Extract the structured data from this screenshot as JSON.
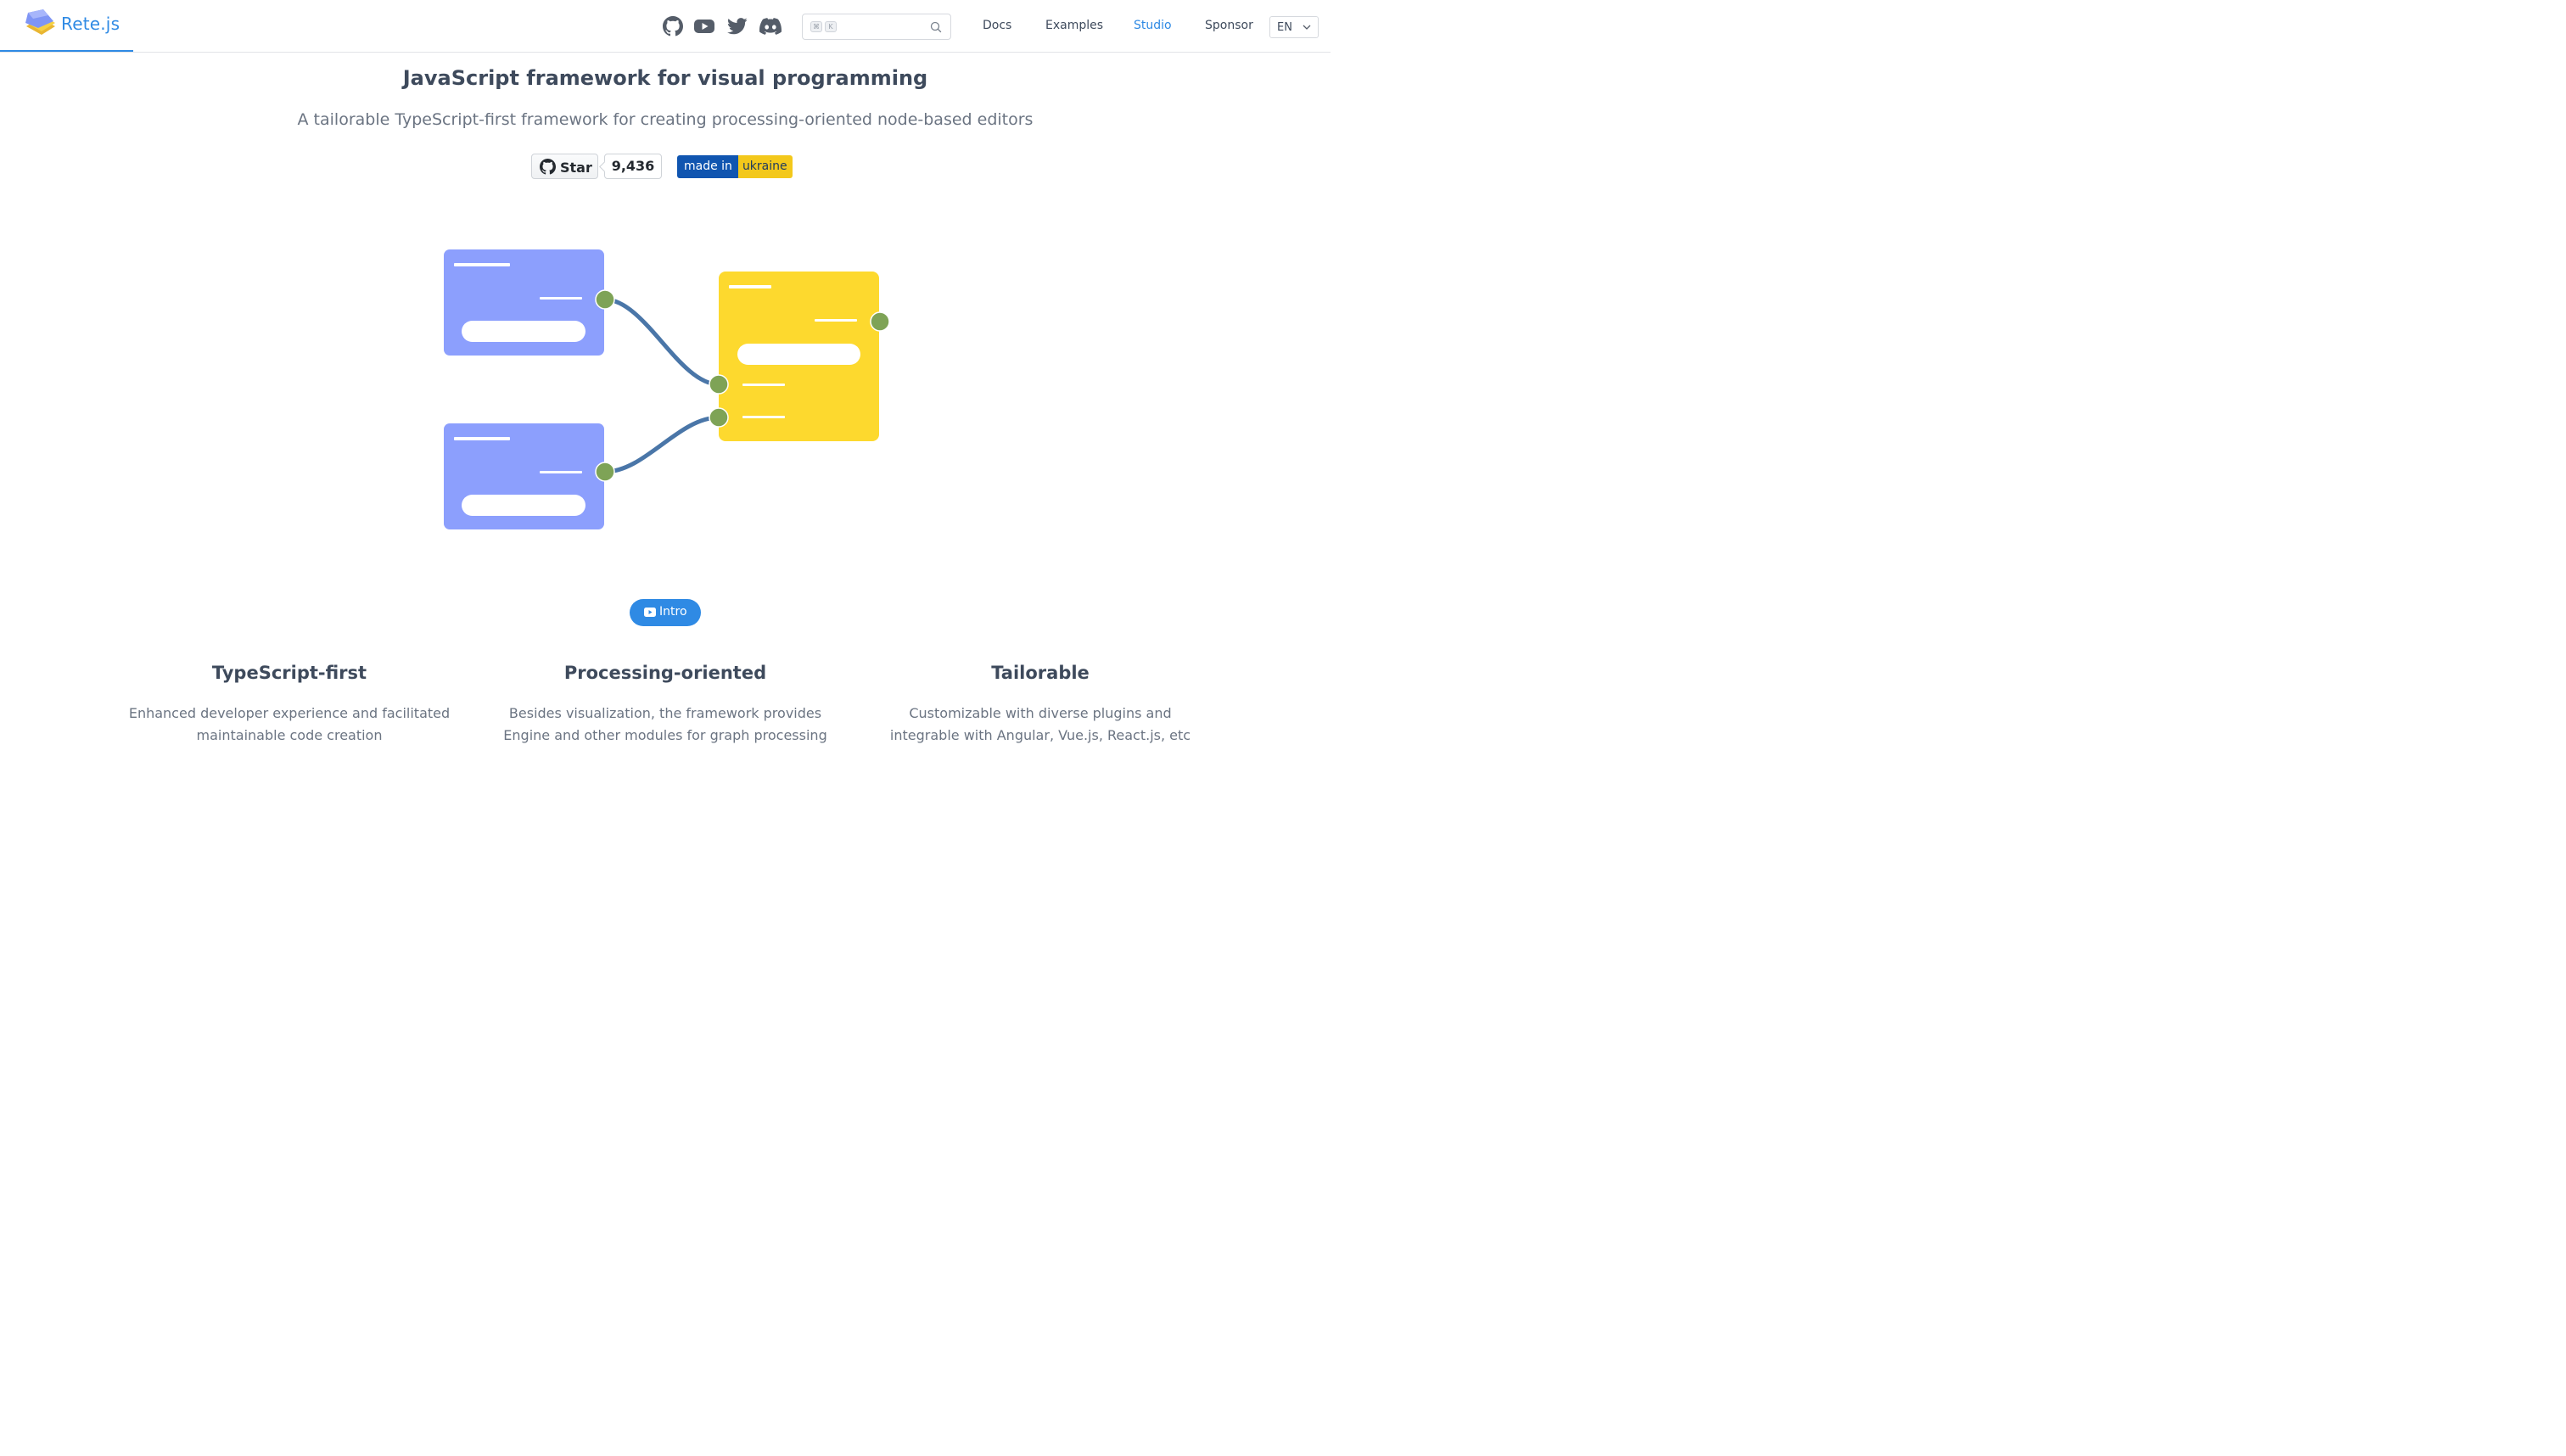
{
  "header": {
    "brand": "Rete.js",
    "social": [
      {
        "name": "github-icon"
      },
      {
        "name": "youtube-icon"
      },
      {
        "name": "twitter-icon"
      },
      {
        "name": "discord-icon"
      }
    ],
    "search": {
      "placeholder": "",
      "shortcut_keys": [
        "⌘",
        "K"
      ]
    },
    "nav": [
      {
        "label": "Docs",
        "active": false
      },
      {
        "label": "Examples",
        "active": false
      },
      {
        "label": "Studio",
        "active": true
      },
      {
        "label": "Sponsor",
        "active": false
      }
    ],
    "language": "EN"
  },
  "hero": {
    "title": "JavaScript framework for visual programming",
    "subtitle": "A tailorable TypeScript-first framework for creating processing-oriented node-based editors",
    "star_label": "Star",
    "star_count": "9,436",
    "badge_left": "made in",
    "badge_right": "ukraine"
  },
  "intro_button": "Intro",
  "features": [
    {
      "title": "TypeScript-first",
      "desc_line1": "Enhanced developer experience and facilitated",
      "desc_line2": "maintainable code creation"
    },
    {
      "title": "Processing-oriented",
      "desc_line1": "Besides visualization, the framework provides",
      "desc_line2": "Engine and other modules for graph processing"
    },
    {
      "title": "Tailorable",
      "desc_line1": "Customizable with diverse plugins and",
      "desc_line2": "integrable with Angular, Vue.js, React.js, etc"
    }
  ],
  "colors": {
    "accent": "#2f8ae4",
    "node_blue": "#8c9ffd",
    "node_yellow": "#fdd92e",
    "socket_green": "#7ea356",
    "connection": "#4a76a8"
  }
}
